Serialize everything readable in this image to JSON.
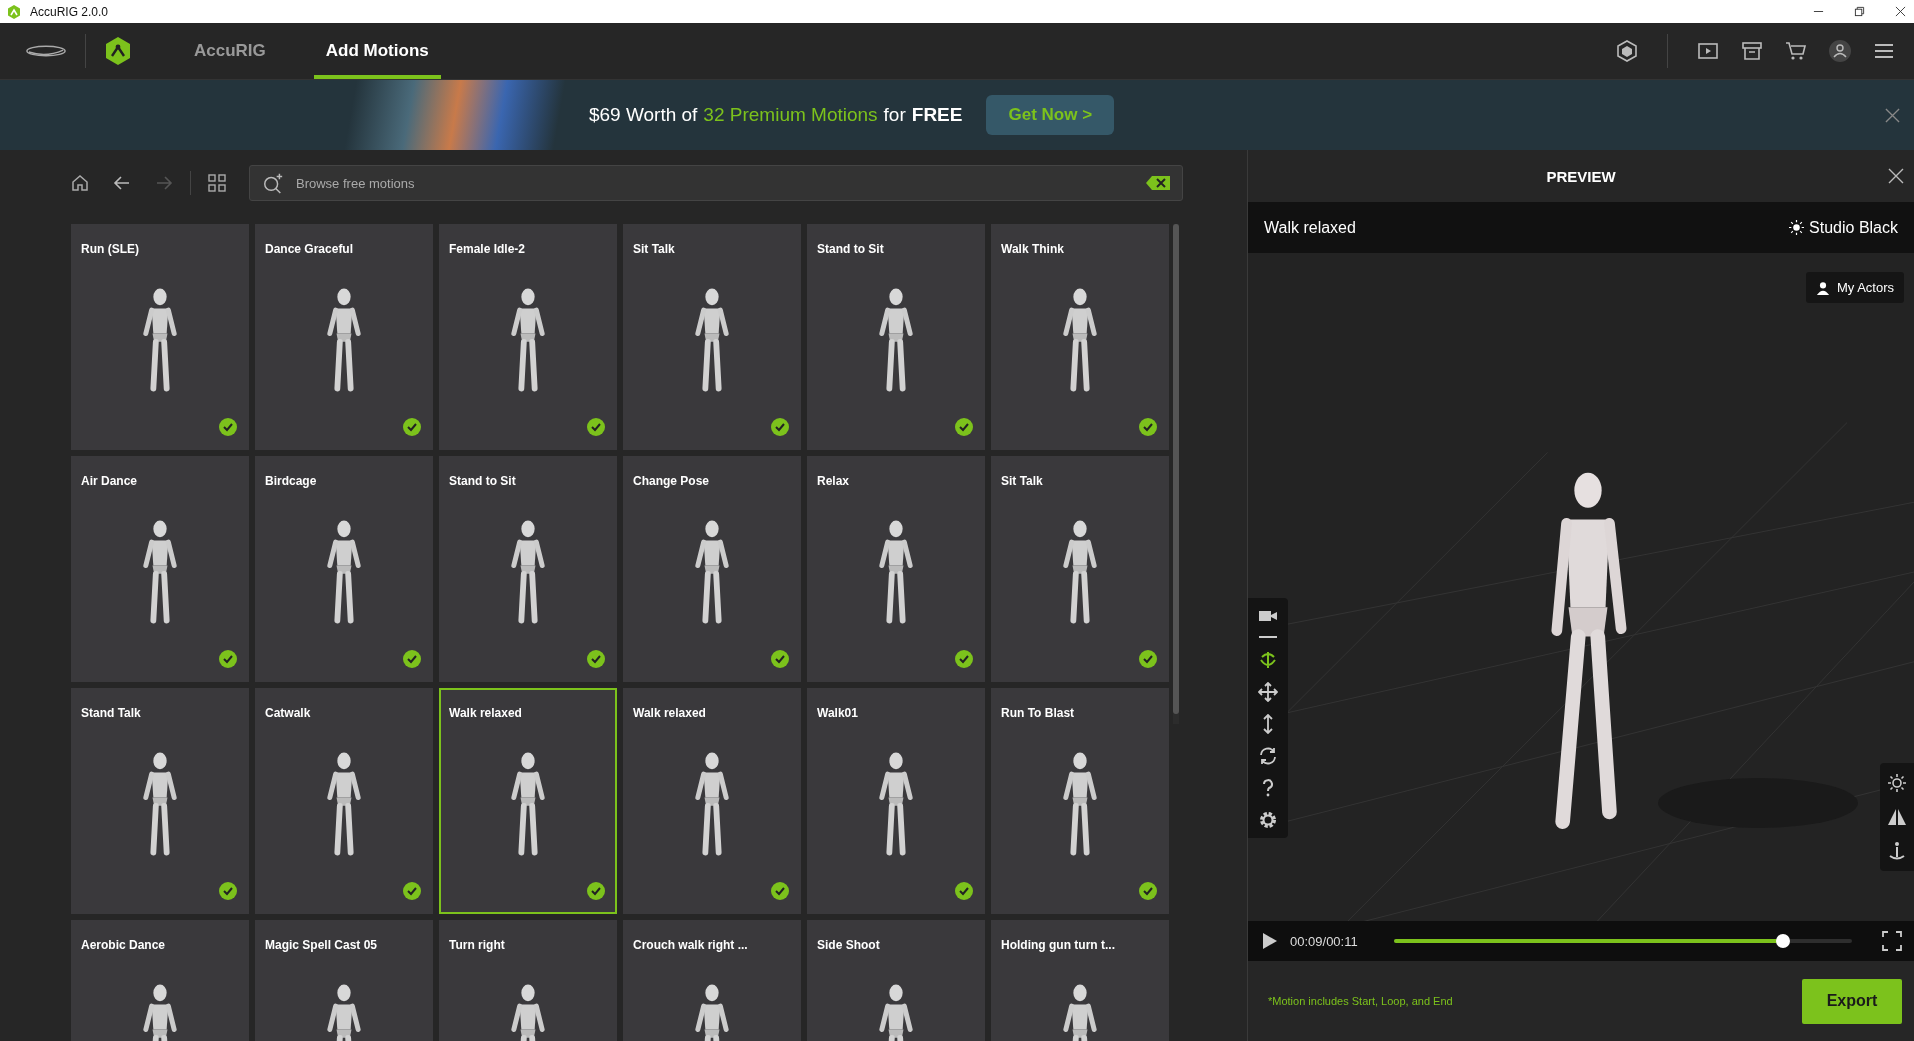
{
  "window": {
    "title": "AccuRIG 2.0.0"
  },
  "nav": {
    "tabs": [
      {
        "label": "AccuRIG",
        "selected": false
      },
      {
        "label": "Add Motions",
        "selected": true
      }
    ]
  },
  "banner": {
    "parts": [
      {
        "text": "$69 Worth of",
        "kind": "plain"
      },
      {
        "text": "32 Premium Motions",
        "kind": "highlight"
      },
      {
        "text": "for",
        "kind": "plain"
      },
      {
        "text": "FREE",
        "kind": "strong"
      }
    ],
    "button": "Get Now >"
  },
  "search": {
    "placeholder": "Browse free motions"
  },
  "motions": [
    {
      "title": "Run (SLE)",
      "selected": false,
      "downloaded": true
    },
    {
      "title": "Dance Graceful",
      "selected": false,
      "downloaded": true
    },
    {
      "title": "Female Idle-2",
      "selected": false,
      "downloaded": true
    },
    {
      "title": "Sit Talk",
      "selected": false,
      "downloaded": true
    },
    {
      "title": "Stand to Sit",
      "selected": false,
      "downloaded": true
    },
    {
      "title": "Walk Think",
      "selected": false,
      "downloaded": true
    },
    {
      "title": "Air Dance",
      "selected": false,
      "downloaded": true
    },
    {
      "title": "Birdcage",
      "selected": false,
      "downloaded": true
    },
    {
      "title": "Stand to Sit",
      "selected": false,
      "downloaded": true
    },
    {
      "title": "Change Pose",
      "selected": false,
      "downloaded": true
    },
    {
      "title": "Relax",
      "selected": false,
      "downloaded": true
    },
    {
      "title": "Sit Talk",
      "selected": false,
      "downloaded": true
    },
    {
      "title": "Stand Talk",
      "selected": false,
      "downloaded": true
    },
    {
      "title": "Catwalk",
      "selected": false,
      "downloaded": true
    },
    {
      "title": "Walk relaxed",
      "selected": true,
      "downloaded": true
    },
    {
      "title": "Walk relaxed",
      "selected": false,
      "downloaded": true
    },
    {
      "title": "Walk01",
      "selected": false,
      "downloaded": true
    },
    {
      "title": "Run To Blast",
      "selected": false,
      "downloaded": true
    },
    {
      "title": "Aerobic Dance",
      "selected": false
    },
    {
      "title": "Magic Spell Cast 05",
      "selected": false
    },
    {
      "title": "Turn right",
      "selected": false
    },
    {
      "title": "Crouch walk right ...",
      "selected": false
    },
    {
      "title": "Side Shoot",
      "selected": false
    },
    {
      "title": "Holding gun turn t...",
      "selected": false
    }
  ],
  "preview": {
    "heading": "PREVIEW",
    "motion_title": "Walk relaxed",
    "environment": "Studio Black",
    "actors_button": "My Actors",
    "tools": [
      {
        "kind": "camera",
        "selected": false
      },
      {
        "kind": "orbit",
        "selected": true
      },
      {
        "kind": "move",
        "selected": false
      },
      {
        "kind": "vertical",
        "selected": false
      },
      {
        "kind": "rotate",
        "selected": false
      },
      {
        "kind": "help",
        "selected": false
      },
      {
        "kind": "settings",
        "selected": false
      }
    ],
    "time": "00:09/00:11",
    "level": 0.85,
    "note": "*Motion includes Start, Loop, and End",
    "export": "Export"
  }
}
